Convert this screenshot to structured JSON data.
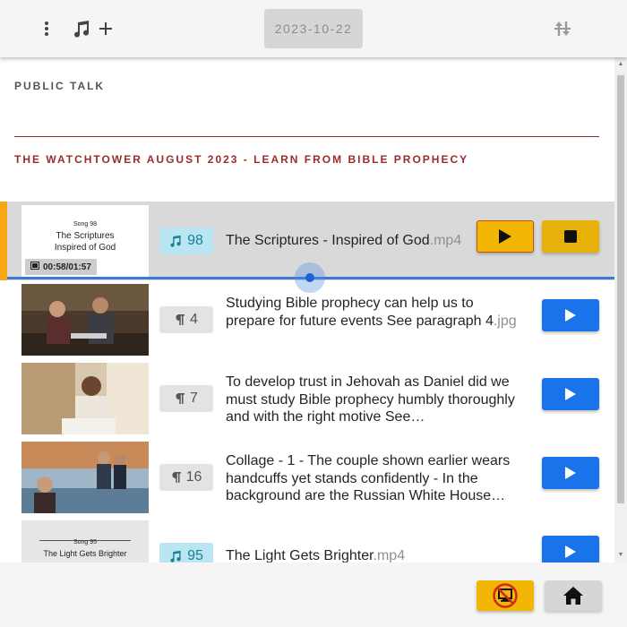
{
  "toolbar": {
    "menu_icon": "vertical-dots-icon",
    "add_song_icon": "music-note-icon",
    "add_icon": "plus-icon",
    "date": "2023-10-22",
    "sort_icon": "sort-arrows-icon"
  },
  "sections": {
    "public_talk": "PUBLIC TALK",
    "watchtower": "THE WATCHTOWER AUGUST 2023 - LEARN FROM BIBLE PROPHECY"
  },
  "items": [
    {
      "type": "song",
      "badge": "98",
      "title": "The Scriptures - Inspired of God",
      "ext": ".mp4",
      "time": "00:58/01:57",
      "thumb_text": [
        "Song 98",
        "The Scriptures",
        "Inspired of God"
      ],
      "active": true,
      "progress": 0.5
    },
    {
      "type": "paragraph",
      "badge": "4",
      "title": "Studying Bible prophecy can help us to prepare for future events See paragraph 4",
      "ext": ".jpg"
    },
    {
      "type": "paragraph",
      "badge": "7",
      "title": "To develop trust in Jehovah as Daniel did we must study Bible prophecy humbly thoroughly and with the right motive See…",
      "ext": ""
    },
    {
      "type": "paragraph",
      "badge": "16",
      "title": "Collage - 1 -  The couple shown earlier wears handcuffs yet stands confidently - In the background are the Russian White House…",
      "ext": ""
    },
    {
      "type": "song",
      "badge": "95",
      "title": "The Light Gets Brighter",
      "ext": ".mp4",
      "thumb_text": [
        "Song 95",
        "The Light Gets Brighter"
      ]
    }
  ],
  "footer": {
    "present_icon": "presentation-off-icon",
    "home_icon": "home-icon"
  },
  "colors": {
    "accent_blue": "#1a73e8",
    "gold": "#f2b705",
    "heading_red": "#9b2c2c",
    "active_marker": "#f7a614"
  }
}
